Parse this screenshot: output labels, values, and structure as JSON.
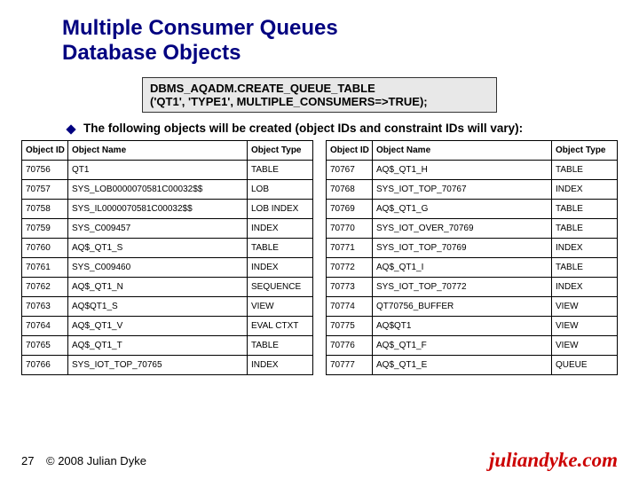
{
  "title_lines": [
    "Multiple Consumer Queues",
    "Database Objects"
  ],
  "code": "DBMS_AQADM.CREATE_QUEUE_TABLE\n('QT1', 'TYPE1', MULTIPLE_CONSUMERS=>TRUE);",
  "subtext": "The following objects will be created (object IDs and constraint IDs will vary):",
  "columns": [
    "Object ID",
    "Object Name",
    "Object Type"
  ],
  "left_rows": [
    {
      "id": "70756",
      "name": "QT1",
      "type": "TABLE"
    },
    {
      "id": "70757",
      "name": "SYS_LOB0000070581C00032$$",
      "type": "LOB"
    },
    {
      "id": "70758",
      "name": "SYS_IL0000070581C00032$$",
      "type": "LOB INDEX"
    },
    {
      "id": "70759",
      "name": "SYS_C009457",
      "type": "INDEX"
    },
    {
      "id": "70760",
      "name": "AQ$_QT1_S",
      "type": "TABLE"
    },
    {
      "id": "70761",
      "name": "SYS_C009460",
      "type": "INDEX"
    },
    {
      "id": "70762",
      "name": "AQ$_QT1_N",
      "type": "SEQUENCE"
    },
    {
      "id": "70763",
      "name": "AQ$QT1_S",
      "type": "VIEW"
    },
    {
      "id": "70764",
      "name": "AQ$_QT1_V",
      "type": "EVAL CTXT"
    },
    {
      "id": "70765",
      "name": "AQ$_QT1_T",
      "type": "TABLE"
    },
    {
      "id": "70766",
      "name": "SYS_IOT_TOP_70765",
      "type": "INDEX"
    }
  ],
  "right_rows": [
    {
      "id": "70767",
      "name": "AQ$_QT1_H",
      "type": "TABLE"
    },
    {
      "id": "70768",
      "name": "SYS_IOT_TOP_70767",
      "type": "INDEX"
    },
    {
      "id": "70769",
      "name": "AQ$_QT1_G",
      "type": "TABLE"
    },
    {
      "id": "70770",
      "name": "SYS_IOT_OVER_70769",
      "type": "TABLE"
    },
    {
      "id": "70771",
      "name": "SYS_IOT_TOP_70769",
      "type": "INDEX"
    },
    {
      "id": "70772",
      "name": "AQ$_QT1_I",
      "type": "TABLE"
    },
    {
      "id": "70773",
      "name": "SYS_IOT_TOP_70772",
      "type": "INDEX"
    },
    {
      "id": "70774",
      "name": "QT70756_BUFFER",
      "type": "VIEW"
    },
    {
      "id": "70775",
      "name": "AQ$QT1",
      "type": "VIEW"
    },
    {
      "id": "70776",
      "name": "AQ$_QT1_F",
      "type": "VIEW"
    },
    {
      "id": "70777",
      "name": "AQ$_QT1_E",
      "type": "QUEUE"
    }
  ],
  "footer": {
    "slide_num": "27",
    "copyright": "© 2008 Julian Dyke",
    "brand": "juliandyke.com"
  }
}
